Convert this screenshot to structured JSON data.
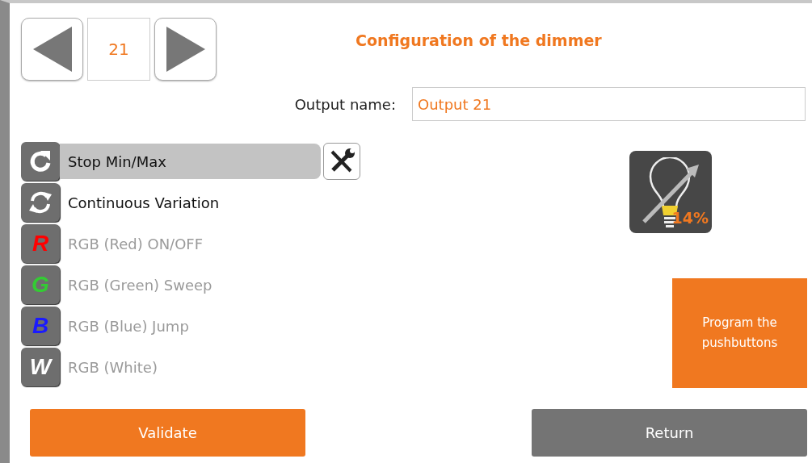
{
  "navigator": {
    "number": "21"
  },
  "title": "Configuration of the dimmer",
  "output_name": {
    "label": "Output name:",
    "value": "Output 21"
  },
  "modes": [
    {
      "kind": "rotate",
      "label": "Stop Min/Max",
      "selected": true,
      "disabled": false
    },
    {
      "kind": "cycle",
      "label": "Continuous Variation",
      "selected": false,
      "disabled": false
    },
    {
      "kind": "letter",
      "letter": "R",
      "color": "#ff0000",
      "label": "RGB (Red) ON/OFF",
      "selected": false,
      "disabled": true
    },
    {
      "kind": "letter",
      "letter": "G",
      "color": "#33cc33",
      "label": "RGB (Green) Sweep",
      "selected": false,
      "disabled": true
    },
    {
      "kind": "letter",
      "letter": "B",
      "color": "#1a1aff",
      "label": "RGB (Blue) Jump",
      "selected": false,
      "disabled": true
    },
    {
      "kind": "letter",
      "letter": "W",
      "color": "#ffffff",
      "label": "RGB (White)",
      "selected": false,
      "disabled": true
    }
  ],
  "dimmer_tile": {
    "reading": "14%"
  },
  "program_button": "Program the pushbuttons",
  "buttons": [
    {
      "kind": "primary",
      "label": "Validate"
    },
    {
      "kind": "secondary",
      "label": "Return"
    }
  ]
}
